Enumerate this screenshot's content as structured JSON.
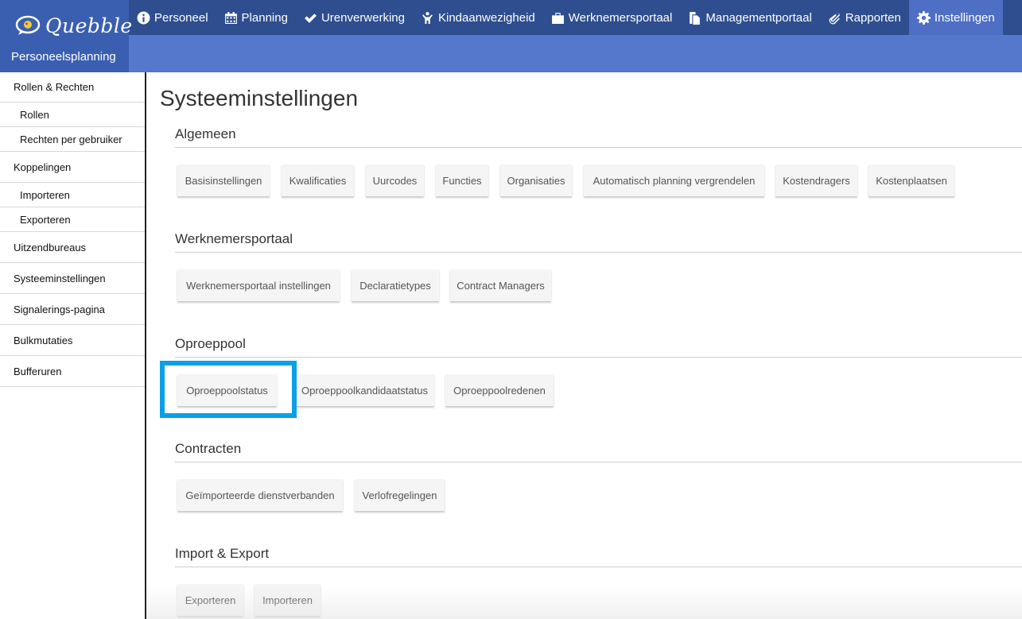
{
  "brand": {
    "logo_text": "Quebble",
    "subtitle": "Personeelsplanning"
  },
  "nav": [
    {
      "label": "Personeel",
      "icon": "info-circle-icon"
    },
    {
      "label": "Planning",
      "icon": "calendar-icon"
    },
    {
      "label": "Urenverwerking",
      "icon": "checkmark-icon"
    },
    {
      "label": "Kindaanwezigheid",
      "icon": "child-icon"
    },
    {
      "label": "Werknemersportaal",
      "icon": "briefcase-icon"
    },
    {
      "label": "Managementportaal",
      "icon": "documents-icon"
    },
    {
      "label": "Rapporten",
      "icon": "paperclip-icon"
    },
    {
      "label": "Instellingen",
      "icon": "gear-icon",
      "active": true
    }
  ],
  "sidebar": {
    "items": [
      {
        "label": "Rollen & Rechten",
        "level": 0
      },
      {
        "label": "Rollen",
        "level": 1
      },
      {
        "label": "Rechten per gebruiker",
        "level": 1
      },
      {
        "label": "Koppelingen",
        "level": 0
      },
      {
        "label": "Importeren",
        "level": 1
      },
      {
        "label": "Exporteren",
        "level": 1
      },
      {
        "label": "Uitzendbureaus",
        "level": 0
      },
      {
        "label": "Systeeminstellingen",
        "level": 0
      },
      {
        "label": "Signalerings-pagina",
        "level": 0
      },
      {
        "label": "Bulkmutaties",
        "level": 0
      },
      {
        "label": "Bufferuren",
        "level": 0
      }
    ]
  },
  "main": {
    "title": "Systeeminstellingen",
    "sections": [
      {
        "title": "Algemeen",
        "buttons": [
          "Basisinstellingen",
          "Kwalificaties",
          "Uurcodes",
          "Functies",
          "Organisaties",
          "Automatisch planning vergrendelen",
          "Kostendragers",
          "Kostenplaatsen"
        ]
      },
      {
        "title": "Werknemersportaal",
        "buttons": [
          "Werknemersportaal instellingen",
          "Declaratietypes",
          "Contract Managers"
        ]
      },
      {
        "title": "Oproeppool",
        "buttons": [
          "Oproeppoolstatus",
          "Oproeppoolkandidaatstatus",
          "Oproeppoolredenen"
        ]
      },
      {
        "title": "Contracten",
        "buttons": [
          "Geïmporteerde dienstverbanden",
          "Verlofregelingen"
        ]
      },
      {
        "title": "Import & Export",
        "buttons": [
          "Exporteren",
          "Importeren"
        ]
      }
    ]
  },
  "colors": {
    "topbar": "#2f4e8f",
    "subbar": "#5577cc",
    "highlight": "#0aa0e8"
  }
}
